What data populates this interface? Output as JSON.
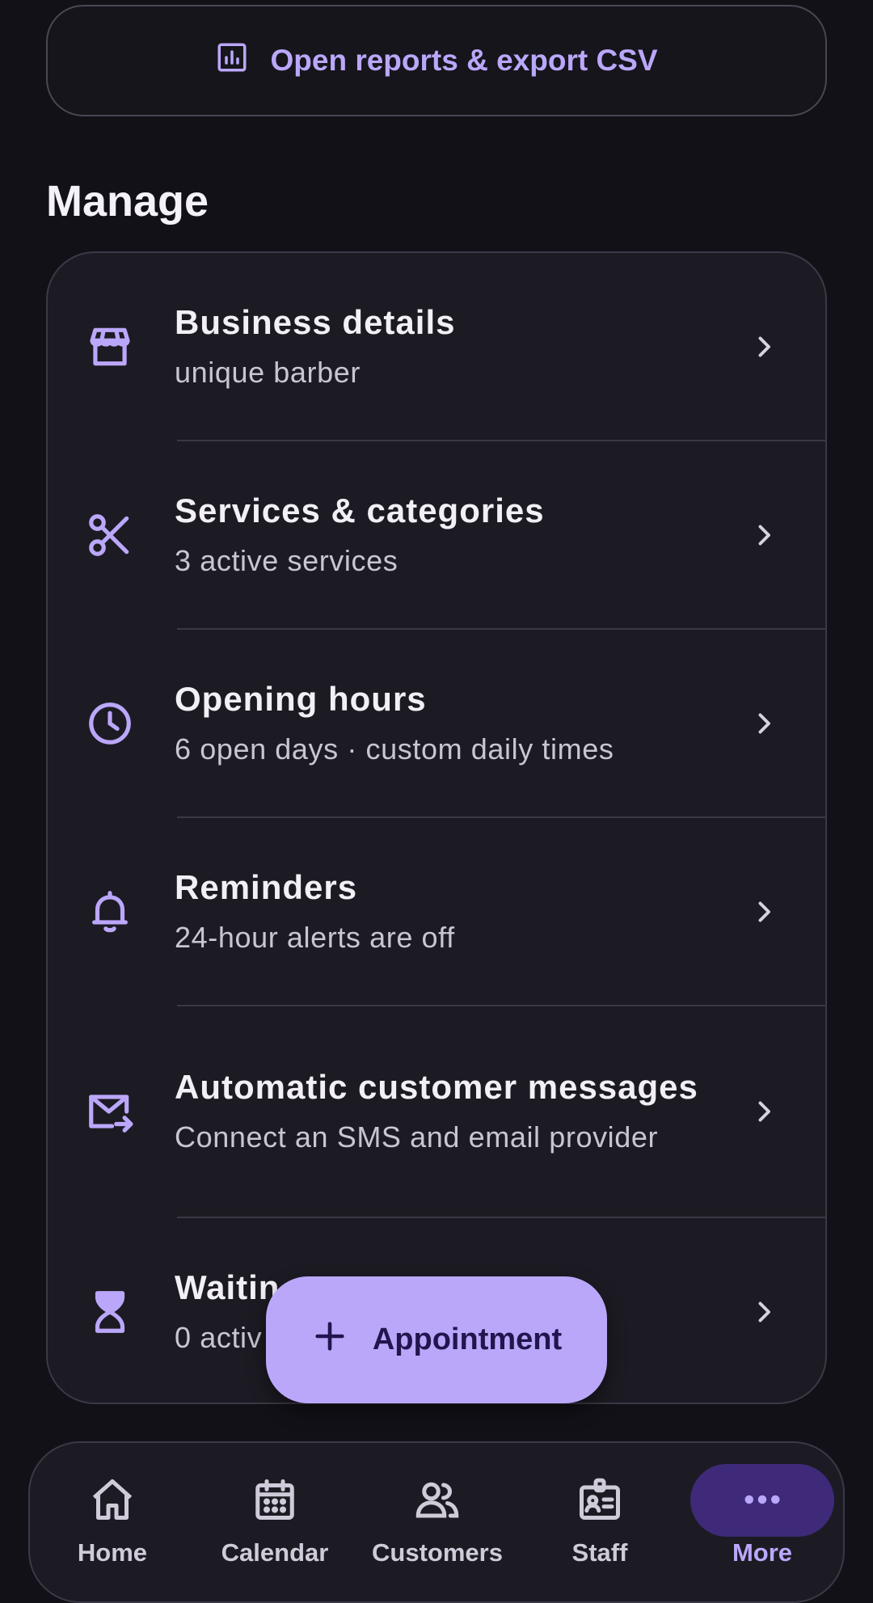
{
  "reports_button": {
    "label": "Open reports & export CSV",
    "icon": "bar-chart-icon"
  },
  "section": {
    "title": "Manage"
  },
  "manage_items": [
    {
      "title": "Business details",
      "subtitle": "unique barber",
      "icon": "storefront-icon"
    },
    {
      "title": "Services & categories",
      "subtitle": "3 active services",
      "icon": "scissors-icon"
    },
    {
      "title": "Opening hours",
      "subtitle": "6 open days · custom daily times",
      "icon": "clock-icon"
    },
    {
      "title": "Reminders",
      "subtitle": "24-hour alerts are off",
      "icon": "bell-icon"
    },
    {
      "title": "Automatic customer messages",
      "subtitle": "Connect an SMS and email provider",
      "icon": "mail-forward-icon"
    },
    {
      "title": "Waitin",
      "subtitle": "0 activ",
      "icon": "hourglass-icon"
    }
  ],
  "fab": {
    "label": "Appointment",
    "icon": "plus-icon"
  },
  "bottom_nav": {
    "active": "More",
    "items": [
      {
        "label": "Home",
        "icon": "home-icon"
      },
      {
        "label": "Calendar",
        "icon": "calendar-icon"
      },
      {
        "label": "Customers",
        "icon": "people-icon"
      },
      {
        "label": "Staff",
        "icon": "badge-icon"
      },
      {
        "label": "More",
        "icon": "more-dots-icon"
      }
    ]
  },
  "colors": {
    "background": "#121118",
    "surface": "#1C1B23",
    "accent": "#BBA7FA",
    "accent_dark": "#3E2A79",
    "text_primary": "#F2EFF7",
    "text_secondary": "#C9C5D1"
  }
}
